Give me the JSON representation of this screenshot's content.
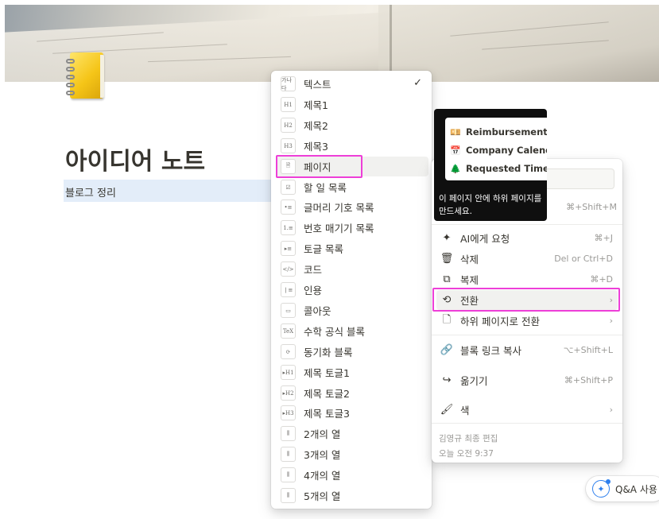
{
  "page": {
    "title": "아이디어 노트",
    "subtitle": "블로그 정리"
  },
  "block_menu": {
    "items": [
      {
        "label": "텍스트",
        "icon_text": "가나다",
        "icon": "text-block-icon",
        "checked": true
      },
      {
        "label": "제목1",
        "icon_text": "H1",
        "icon": "heading1-icon"
      },
      {
        "label": "제목2",
        "icon_text": "H2",
        "icon": "heading2-icon"
      },
      {
        "label": "제목3",
        "icon_text": "H3",
        "icon": "heading3-icon"
      },
      {
        "label": "페이지",
        "icon_text": "🗎",
        "icon": "page-icon",
        "active": true
      },
      {
        "label": "할 일 목록",
        "icon_text": "☑",
        "icon": "todo-list-icon"
      },
      {
        "label": "글머리 기호 목록",
        "icon_text": "•≡",
        "icon": "bulleted-list-icon"
      },
      {
        "label": "번호 매기기 목록",
        "icon_text": "1.≡",
        "icon": "numbered-list-icon"
      },
      {
        "label": "토글 목록",
        "icon_text": "▸≡",
        "icon": "toggle-list-icon"
      },
      {
        "label": "코드",
        "icon_text": "</>",
        "icon": "code-icon"
      },
      {
        "label": "인용",
        "icon_text": "❘≡",
        "icon": "quote-icon"
      },
      {
        "label": "콜아웃",
        "icon_text": "▭",
        "icon": "callout-icon"
      },
      {
        "label": "수학 공식 블록",
        "icon_text": "TeX",
        "icon": "math-equation-icon"
      },
      {
        "label": "동기화 블록",
        "icon_text": "⟳",
        "icon": "synced-block-icon"
      },
      {
        "label": "제목 토글1",
        "icon_text": "▸H1",
        "icon": "toggle-heading1-icon"
      },
      {
        "label": "제목 토글2",
        "icon_text": "▸H2",
        "icon": "toggle-heading2-icon"
      },
      {
        "label": "제목 토글3",
        "icon_text": "▸H3",
        "icon": "toggle-heading3-icon"
      },
      {
        "label": "2개의 열",
        "icon_text": "⫼",
        "icon": "columns-2-icon"
      },
      {
        "label": "3개의 열",
        "icon_text": "⫼",
        "icon": "columns-3-icon"
      },
      {
        "label": "4개의 열",
        "icon_text": "⫼",
        "icon": "columns-4-icon"
      },
      {
        "label": "5개의 열",
        "icon_text": "⫼",
        "icon": "columns-5-icon"
      }
    ]
  },
  "tooltip": {
    "preview_items": [
      {
        "label": "Reimbursement",
        "icon": "money-envelope-icon",
        "glyph": "💴"
      },
      {
        "label": "Company Calend",
        "icon": "calendar-icon",
        "glyph": "📅"
      },
      {
        "label": "Requested Time",
        "icon": "tree-icon",
        "glyph": "🌲"
      }
    ],
    "description": "이 페이지 안에 하위 페이지를 만드세요."
  },
  "context_menu": {
    "top_shortcut": "⌘+Shift+M",
    "items": [
      {
        "label": "AI에게 요청",
        "shortcut": "⌘+J",
        "icon": "ai-sparkle-icon",
        "glyph": "✦"
      },
      {
        "label": "삭제",
        "shortcut": "Del or Ctrl+D",
        "icon": "trash-icon",
        "glyph": "🗑"
      },
      {
        "label": "복제",
        "shortcut": "⌘+D",
        "icon": "duplicate-icon",
        "glyph": "⧉"
      },
      {
        "label": "전환",
        "shortcut": "›",
        "icon": "turn-into-icon",
        "glyph": "⟲",
        "active": true
      },
      {
        "label": "하위 페이지로 전환",
        "shortcut": "›",
        "icon": "page-outline-icon",
        "glyph": "🗋"
      },
      {
        "label": "블록 링크 복사",
        "shortcut": "⌥+Shift+L",
        "icon": "link-icon",
        "glyph": "🔗"
      },
      {
        "label": "옮기기",
        "shortcut": "⌘+Shift+P",
        "icon": "move-arrow-icon",
        "glyph": "↪"
      },
      {
        "label": "색",
        "shortcut": "›",
        "icon": "paint-roller-icon",
        "glyph": "🖌"
      }
    ],
    "edited_by": "김영규 최종 편집",
    "edited_time": "오늘 오전 9:37"
  },
  "qa_button": {
    "label": "Q&A 사용"
  }
}
